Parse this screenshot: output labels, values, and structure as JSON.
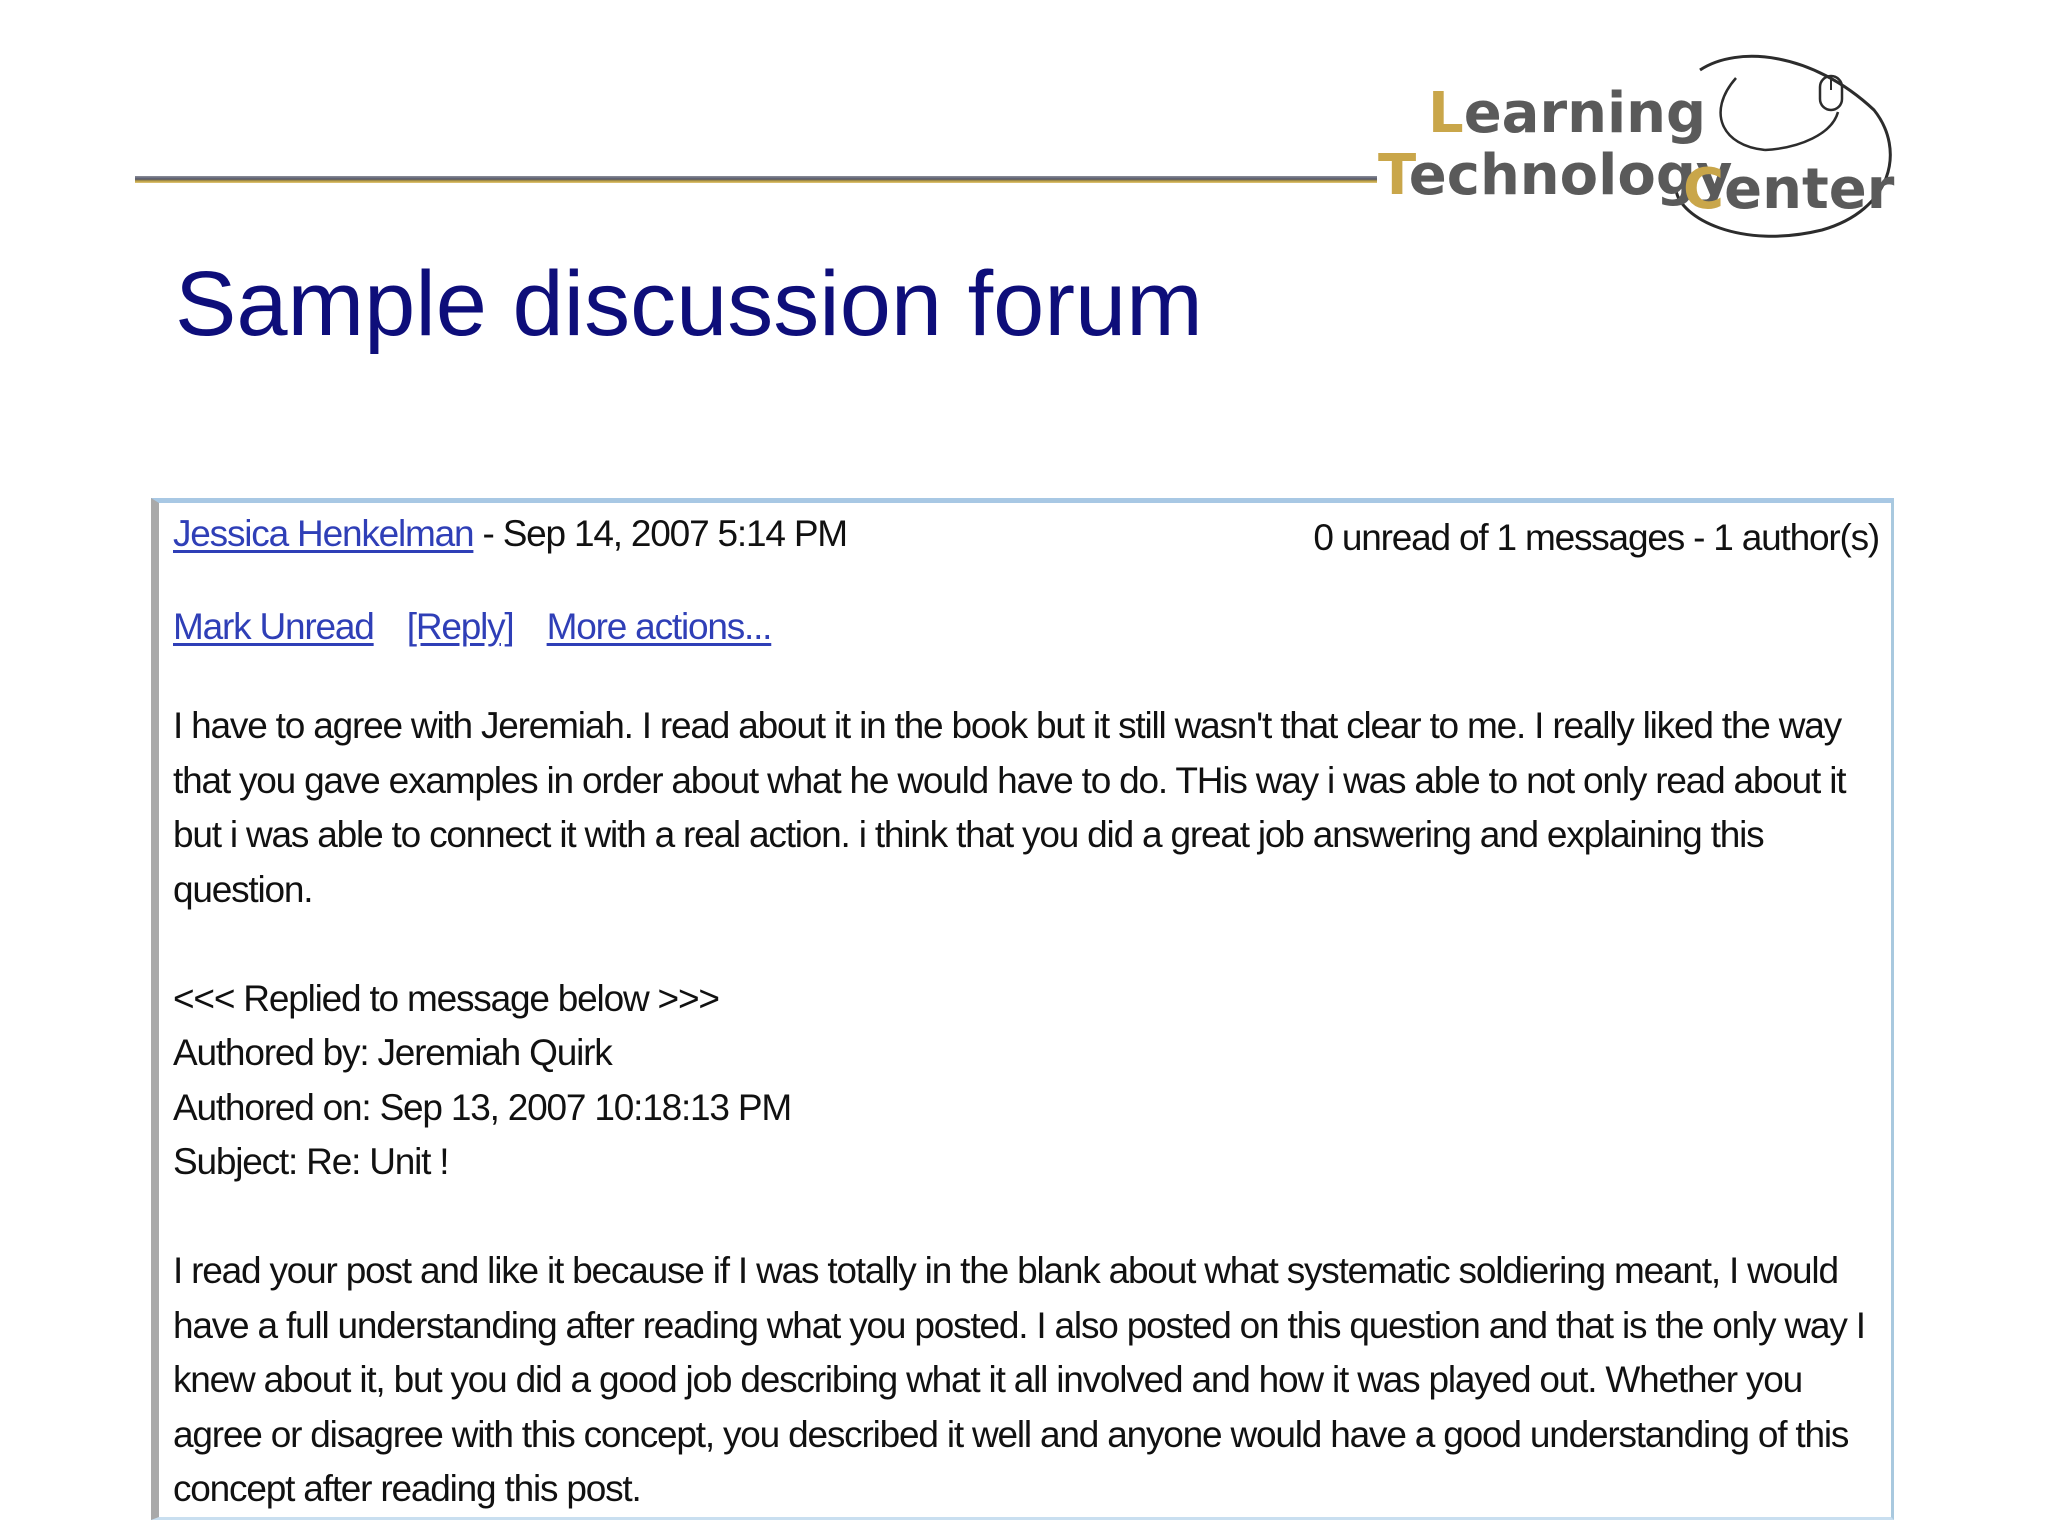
{
  "slide": {
    "title": "Sample discussion forum"
  },
  "logo": {
    "line1": "Learning",
    "line2": "Technology",
    "line3": "Center",
    "colors": {
      "text": "#5a5a5a",
      "initial": "#c9a64a",
      "ring": "#2c2c2c"
    }
  },
  "post": {
    "author": "Jessica Henkelman",
    "date": "- Sep 14, 2007 5:14 PM",
    "meta": "0 unread of 1 messages - 1 author(s)",
    "actions": {
      "mark_unread": "Mark Unread",
      "reply": "[Reply]",
      "more": "More actions..."
    },
    "body": "I have to agree with Jeremiah.  I read about it in the book but it still wasn't that clear to me.  I really liked the way that you gave examples in order about what he would have to do.  THis way i was able to not only read about it but i was able to connect it with a real action.  i think that you did a great job answering and explaining this question.",
    "quote": {
      "marker": "<<< Replied to message below >>>",
      "authored_by": "Authored by: Jeremiah Quirk",
      "authored_on": "Authored on: Sep 13, 2007 10:18:13 PM",
      "subject": "Subject: Re: Unit !",
      "body": "I read your post and like it because if I was totally in the blank about what systematic soldiering meant, I would have a full understanding after reading what you posted.  I also posted on this question and that is the only way I knew about it, but you did a good job describing what it all involved and how it was played out.  Whether you agree or disagree with this concept, you described it well and anyone would have a good understanding of this concept after reading this post."
    }
  },
  "colors": {
    "title": "#0e0e7a",
    "link": "#2f3fb7",
    "text": "#111111"
  }
}
